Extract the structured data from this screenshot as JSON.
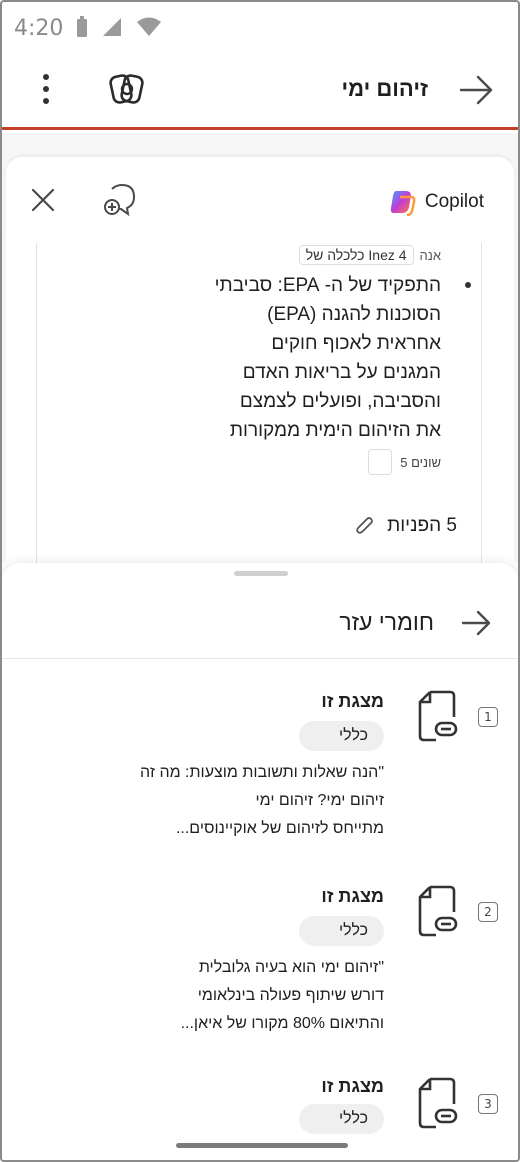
{
  "status_bar": {
    "time": "4:20"
  },
  "app_bar": {
    "title": "זיהום ימי"
  },
  "copilot": {
    "brand_label": "Copilot",
    "brand_color": "#c4402a",
    "meta": {
      "prefix": "אנה",
      "source_chip": "Inez 4 כלכלה של"
    },
    "bullet_lines": [
      "התפקיד של ה- EPA: סביבתי",
      "הסוכנות להגנה (EPA)",
      "אחראית לאכוף חוקים",
      "המגנים על בריאות האדם",
      "והסביבה, ופועלים לצמצם",
      "את הזיהום הימית ממקורות"
    ],
    "ref_note": "שונים 5",
    "attachments_label": "5 הפניות"
  },
  "references_sheet": {
    "title": "חומרי עזר",
    "items": [
      {
        "number": "1",
        "title": "מצגת זו",
        "tag": "כללי",
        "excerpt_lines": [
          "\"הנה שאלות ותשובות מוצעות: מה זה",
          "זיהום ימי? זיהום ימי",
          "מתייחס לזיהום של אוקיינוסים..."
        ]
      },
      {
        "number": "2",
        "title": "מצגת זו",
        "tag": "כללי",
        "excerpt_lines": [
          "\"זיהום ימי הוא בעיה גלובלית",
          "דורש שיתוף פעולה בינלאומי",
          "והתיאום 80% מקורו של איאן..."
        ]
      },
      {
        "number": "3",
        "title": "מצגת זו",
        "tag": "כללי",
        "excerpt_lines": []
      }
    ]
  }
}
